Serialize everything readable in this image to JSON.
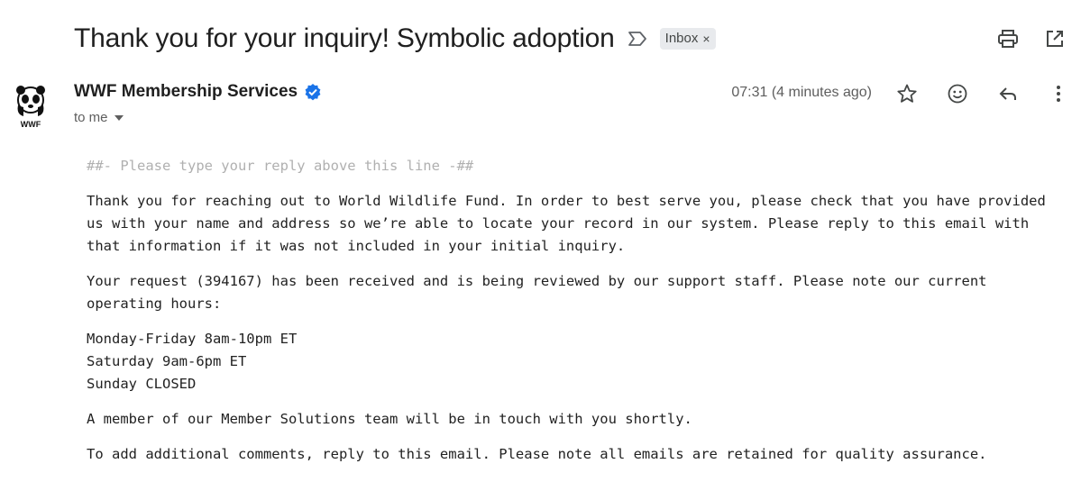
{
  "subject": {
    "title": "Thank you for your inquiry! Symbolic adoption",
    "label": "Inbox",
    "label_close": "×"
  },
  "toolbar": {
    "icons": [
      "importance-icon",
      "print-icon",
      "open-in-new-window-icon"
    ]
  },
  "sender": {
    "name": "WWF Membership Services",
    "recipient": "to me",
    "time": "07:31 (4 minutes ago)",
    "avatar_logo_text": "WWF",
    "icons": [
      "star-icon",
      "emoji-reaction-icon",
      "reply-icon",
      "more-vert-icon"
    ]
  },
  "body": {
    "reply_line": "##- Please type your reply above this line -##",
    "para1": "Thank you for reaching out to World Wildlife Fund. In order to best serve you, please check that you have provided us with your name and address so we’re able to locate your record in our system. Please reply to this email with that information if it was not included in your initial inquiry.",
    "para2": "Your request (394167) has been received and is being reviewed by our support staff. Please note our current operating hours:",
    "hours": [
      "Monday-Friday 8am-10pm ET",
      "Saturday 9am-6pm ET",
      "Sunday CLOSED"
    ],
    "para3": "A member of our Member Solutions team will be in touch with you shortly.",
    "para4": "To add additional comments, reply to this email. Please note all emails are retained for quality assurance."
  },
  "colors": {
    "verified_badge": "#1a73e8",
    "chip_bg": "#e8eaed",
    "muted_text": "#5e5e5e",
    "reply_line_text": "#b0b0b0"
  }
}
